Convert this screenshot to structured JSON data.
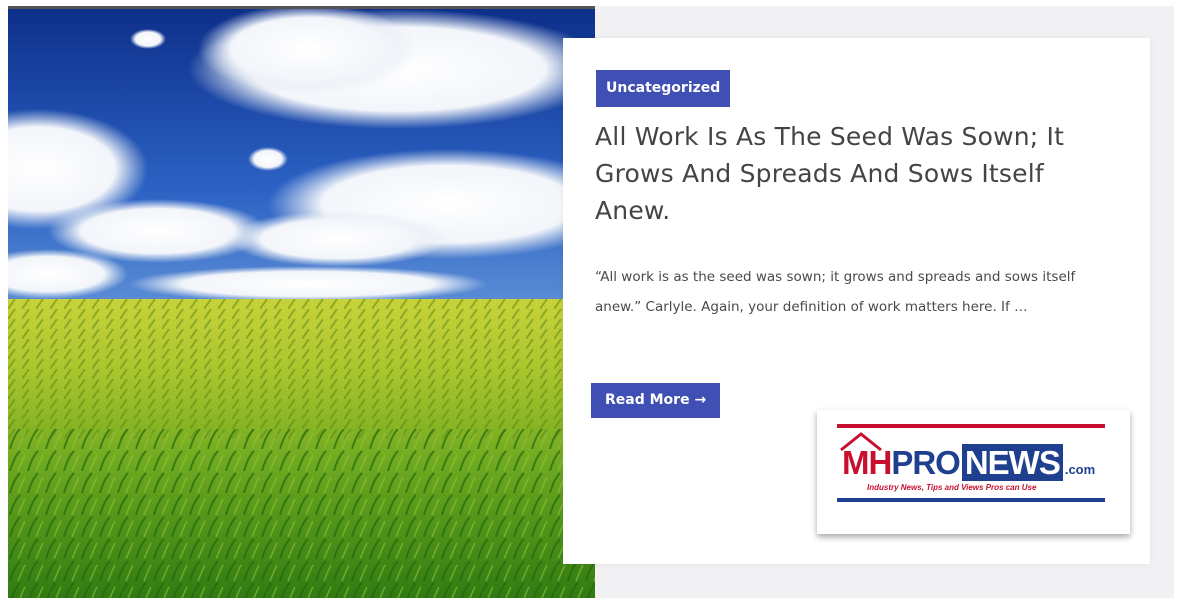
{
  "post": {
    "category": "Uncategorized",
    "title": "All Work Is As The Seed Was Sown; It Grows And Spreads And Sows Itself Anew.",
    "excerpt": "“All work is as the seed was sown; it grows and spreads and sows itself anew.” Carlyle. Again, your definition of work matters here. If …",
    "read_more_label": "Read More →"
  },
  "logo": {
    "mh": "MH",
    "pro": "PRO",
    "news": "NEWS",
    "domain": ".com",
    "tagline": "Industry News, Tips and Views Pros can Use"
  },
  "colors": {
    "accent": "#3f4fb3",
    "logo_red": "#c8102e",
    "logo_blue": "#1f3f8f",
    "title_text": "#444444",
    "card_background": "#f1f1f3"
  },
  "image": {
    "subject": "corn field under blue sky with white clouds"
  }
}
